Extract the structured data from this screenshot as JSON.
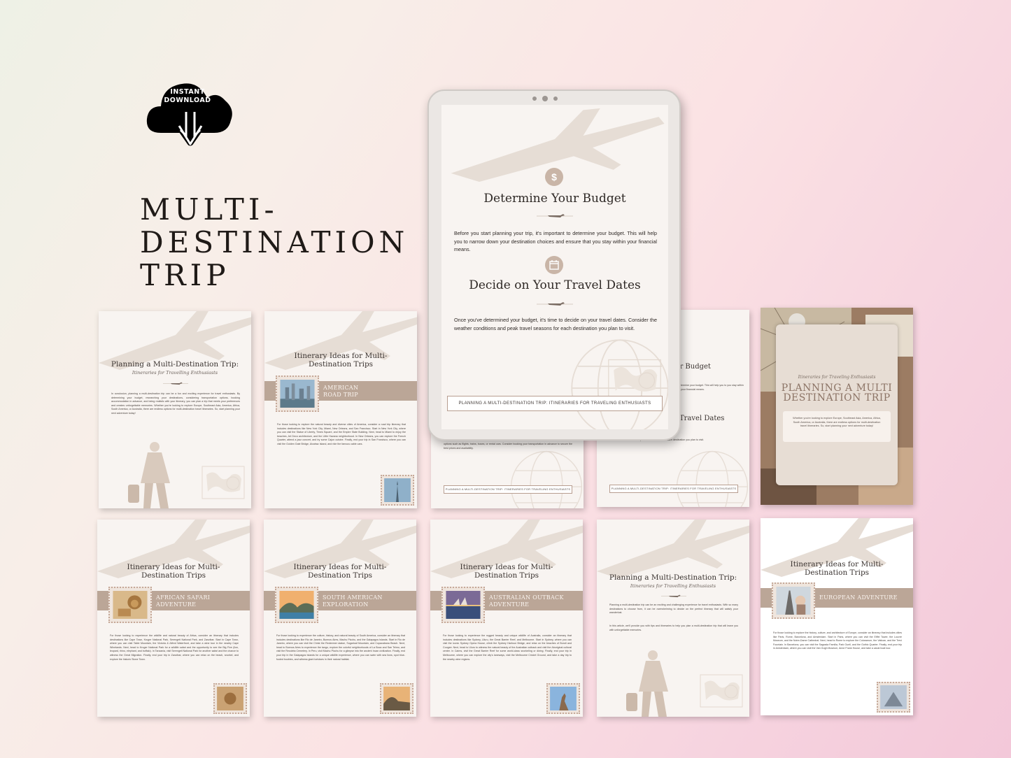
{
  "badge": {
    "line1": "INSTANT",
    "line2": "DOWNLOAD",
    "icon": "cloud-download-icon"
  },
  "title": {
    "line1": "MULTI-",
    "line2": "DESTINATION",
    "line3": "TRIP"
  },
  "tablet": {
    "section1_title": "Determine Your Budget",
    "section1_icon": "dollar-icon",
    "section1_icon_text": "$",
    "section1_body": "Before you start planning your trip, it's important to determine your budget. This will help you to narrow down your destination choices and ensure that you stay within your financial means.",
    "section2_title": "Decide on Your Travel Dates",
    "section2_icon": "calendar-icon",
    "section2_body": "Once you've determined your budget, it's time to decide on your travel dates. Consider the weather conditions and peak travel seasons for each destination you plan to visit.",
    "footer": "PLANNING A MULTI-DESTINATION TRIP:  ITINERARIES FOR TRAVELING ENTHUSIASTS"
  },
  "pages": {
    "p1": {
      "title": "Planning a Multi-Destination Trip:",
      "subtitle": "Itineraries for Travelling Enthusiasts",
      "body": "In conclusion, planning a multi-destination trip can be a fun and exciting experience for travel enthusiasts. By determining your budget, researching your destinations, considering transportation options, booking accommodation in advance, and being realistic with your itinerary, you can plan a trip that meets your preferences and creates unforgettable memories. Whether you're looking to explore Europe, Southeast Asia, America, Africa, South America, or Australia, there are endless options for multi-destination travel itineraries. So, start planning your next adventure today!"
    },
    "p2": {
      "title1": "Itinerary Ideas for Multi-",
      "title2": "Destination Trips",
      "band1": "AMERICAN",
      "band2": "ROAD TRIP",
      "body": "For those looking to explore the natural beauty and diverse cities of America, consider a road trip itinerary that includes destinations like New York City, Miami, New Orleans, and San Francisco. Start in New York City, where you can visit the Statue of Liberty, Times Square, and the Empire State Building. Next, head to Miami to enjoy the beaches, Art Deco architecture, and the Little Havana neighborhood. In New Orleans, you can explore the French Quarter, attend a jazz concert, and try some Cajun cuisine. Finally, end your trip in San Francisco, where you can visit the Golden Gate Bridge, Alcatraz Island, and ride the famous cable cars."
    },
    "p3": {
      "body": "options such as flights, trains, buses, or rental cars. Consider booking your transportation in advance to secure the best prices and availability.",
      "footer": "PLANNING A MULTI-DESTINATION TRIP:  ITINERARIES FOR TRAVELING ENTHUSIASTS"
    },
    "p4": {
      "title1": "ur Budget",
      "body1": "termine your budget. This will help you to you stay within your financial means.",
      "title2": "Travel Dates",
      "body2": "weather conditions and peak travel seasons for each destination you plan to visit.",
      "footer": "PLANNING A MULTI-DESTINATION TRIP:  ITINERARIES FOR TRAVELING ENTHUSIASTS"
    },
    "p5": {
      "subtitle": "Itineraries for Traveling Enthusiasts",
      "title1": "PLANNING A MULTI",
      "title2": "DESTINATION TRIP",
      "body": "Whether you're looking to explore Europe, Southeast Asia, America, Africa, South America, or Australia, there are endless options for multi-destination travel itineraries. So, start planning your next adventure today!"
    },
    "p6": {
      "title1": "Itinerary Ideas for Multi-",
      "title2": "Destination Trips",
      "band1": "AFRICAN SAFARI",
      "band2": "ADVENTURE",
      "body": "For those looking to experience the wildlife and natural beauty of Africa, consider an itinerary that includes destinations like Cape Town, Kruger National Park, Serengeti National Park, and Zanzibar. Start in Cape Town, where you can visit Table Mountain, the Victoria & Alfred Waterfront, and take a wine tour in the nearby Cape Winelands. Next, head to Kruger National Park for a wildlife safari and the opportunity to see the Big Five (lion, leopard, rhino, elephant, and buffalo). In Tanzania, visit Serengeti National Park for another safari and the chance to witness the Great Migration. Finally, end your trip in Zanzibar, where you can relax on the beach, snorkel, and explore the historic Stone Town."
    },
    "p7": {
      "title1": "Itinerary Ideas for Multi-",
      "title2": "Destination Trips",
      "band1": "SOUTH AMERICAN",
      "band2": "EXPLORATION",
      "body": "For those looking to experience the culture, history, and natural beauty of South America, consider an itinerary that includes destinations like Rio de Janeiro, Buenos Aires, Machu Picchu, and the Galapagos Islands. Start in Rio de Janeiro, where you can visit the Christ the Redeemer statue, Sugarloaf Mountain, and Copacabana Beach. Next, head to Buenos Aires to experience the tango, explore the colorful neighborhoods of La Boca and San Telmo, and visit the Recoleta Cemetery. In Peru, visit Machu Picchu for a glimpse into the ancient Incan civilization. Finally, end your trip in the Galapagos Islands for a unique wildlife experience, where you can swim with sea lions, spot blue-footed boobies, and witness giant tortoises in their natural habitat."
    },
    "p8": {
      "title1": "Itinerary Ideas for Multi-",
      "title2": "Destination Trips",
      "band1": "AUSTRALIAN OUTBACK",
      "band2": "ADVENTURE",
      "body": "For those looking to experience the rugged beauty and unique wildlife of Australia, consider an itinerary that includes destinations like Sydney, Uluru, the Great Barrier Reef, and Melbourne. Start in Sydney, where you can visit the iconic Sydney Opera House, climb the Sydney Harbour Bridge, and relax on the beaches of Bondi and Coogee. Next, head to Uluru to witness the natural beauty of the Australian outback and visit the Aboriginal cultural center. In Cairns, visit the Great Barrier Reef for some world-class snorkeling or diving. Finally, end your trip in Melbourne, where you can explore the city's laneways, visit the Melbourne Cricket Ground, and take a day trip to the nearby wine regions."
    },
    "p9": {
      "title": "Planning a Multi-Destination Trip:",
      "subtitle": "Itineraries for Travelling Enthusiasts",
      "body1": "Planning a multi-destination trip can be an exciting and challenging experience for travel enthusiasts. With so many destinations to choose from, it can be overwhelming to decide on the perfect itinerary that will satisfy your wanderlust.",
      "body2": "In this article, we'll provide you with tips and itineraries to help you plan a multi-destination trip that will leave you with unforgettable memories."
    },
    "p10": {
      "title1": "Itinerary Ideas for Multi-",
      "title2": "Destination Trips",
      "band1": "EUROPEAN ADVENTURE",
      "band2": "",
      "body": "For those looking to explore the history, culture, and architecture of Europe, consider an itinerary that includes cities like Paris, Rome, Barcelona, and Amsterdam. Start in Paris, where you can visit the Eiffel Tower, the Louvre Museum, and the Notre-Dame Cathedral. Next, head to Rome to explore the Colosseum, the Vatican, and the Trevi Fountain. In Barcelona, you can visit the Sagrada Familia, Park Guell, and the Gothic Quarter. Finally, end your trip in Amsterdam, where you can visit the Van Gogh Museum, Anne Frank House, and take a canal boat tour."
    }
  },
  "colors": {
    "accent": "#bba697",
    "text": "#1f1a17",
    "page": "#f8f4f1"
  }
}
